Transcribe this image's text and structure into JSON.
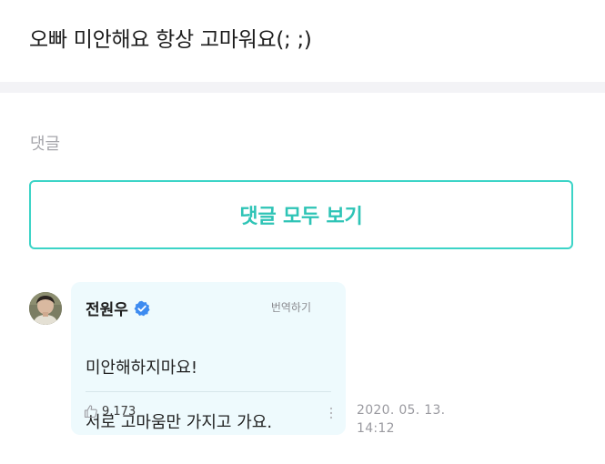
{
  "post": {
    "title": "오빠 미안해요 항상 고마워요(; ;)"
  },
  "comments_section": {
    "label": "댓글",
    "view_all_label": "댓글 모두 보기"
  },
  "comment": {
    "author": "전원우",
    "verified": true,
    "translate_label": "번역하기",
    "text_line1": "미안해하지마요!",
    "text_line2": "서로 고마움만 가지고 가요.",
    "likes": "9,173",
    "date": "2020. 05. 13.",
    "time": "14:12"
  },
  "icons": {
    "verified": "verified-badge-icon",
    "like": "thumbs-up-icon",
    "more": "more-vertical-icon",
    "avatar": "profile-photo"
  },
  "colors": {
    "accent": "#2ec4b6",
    "accent_border": "#3cd4c7",
    "bubble_bg": "#eefafd",
    "verified_blue": "#3d8bf0",
    "muted_text": "#a6a6ab"
  }
}
